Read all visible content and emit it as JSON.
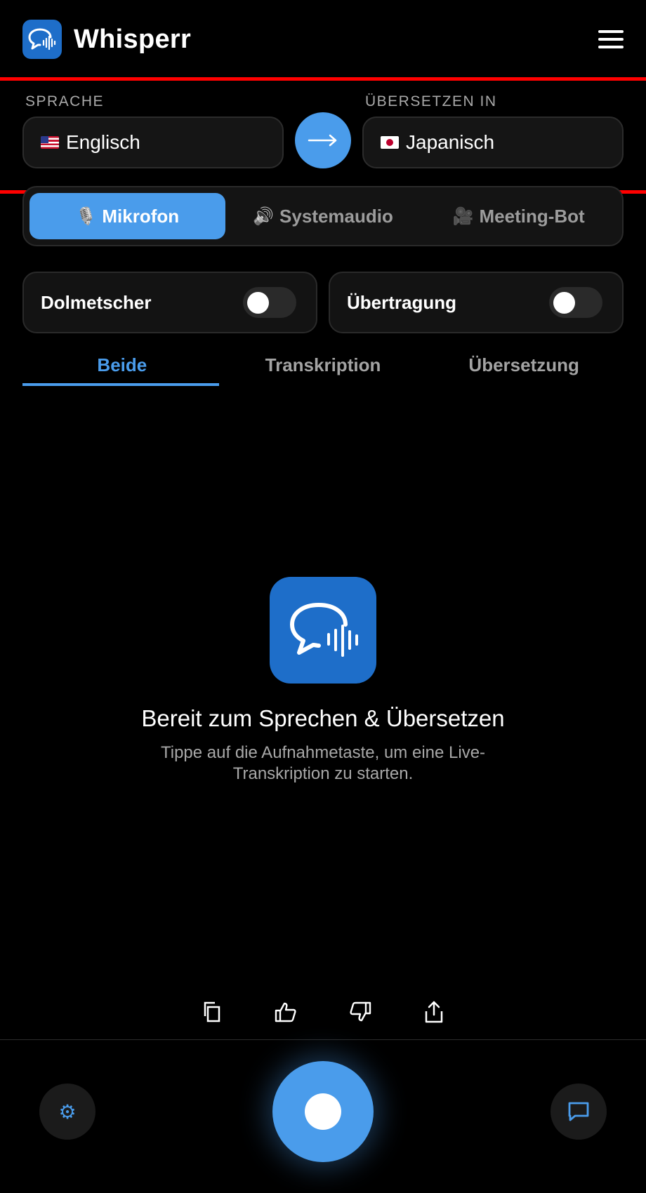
{
  "header": {
    "app_title": "Whisperr",
    "logo_icon": "chat-waveform-icon",
    "menu_icon": "hamburger-menu-icon"
  },
  "languages": {
    "source_label": "SPRACHE",
    "source_value": "Englisch",
    "source_flag": "us-flag-icon",
    "target_label": "ÜBERSETZEN IN",
    "target_value": "Japanisch",
    "target_flag": "jp-flag-icon",
    "swap_icon": "arrow-right-icon"
  },
  "source_modes": [
    {
      "label": "Mikrofon",
      "icon": "🎙️",
      "active": true
    },
    {
      "label": "Systemaudio",
      "icon": "🔊",
      "active": false
    },
    {
      "label": "Meeting-Bot",
      "icon": "🎥",
      "active": false
    }
  ],
  "toggles": {
    "interpreter_label": "Dolmetscher",
    "interpreter_on": false,
    "broadcast_label": "Übertragung",
    "broadcast_on": false
  },
  "tabs": [
    {
      "label": "Beide",
      "active": true
    },
    {
      "label": "Transkription",
      "active": false
    },
    {
      "label": "Übersetzung",
      "active": false
    }
  ],
  "empty_state": {
    "title": "Bereit zum Sprechen & Übersetzen",
    "subtitle": "Tippe auf die Aufnahmetaste, um eine Live-Transkription zu starten."
  },
  "actions": [
    "copy-icon",
    "thumbs-up-icon",
    "thumbs-down-icon",
    "share-icon"
  ],
  "bottom_bar": {
    "settings_icon": "⚙",
    "record_icon": "record-icon",
    "chat_icon": "chat-bubble-icon"
  },
  "colors": {
    "accent": "#4a9ceb",
    "brand": "#1e6ec9",
    "highlight_line": "#ff0000",
    "background": "#000000"
  }
}
